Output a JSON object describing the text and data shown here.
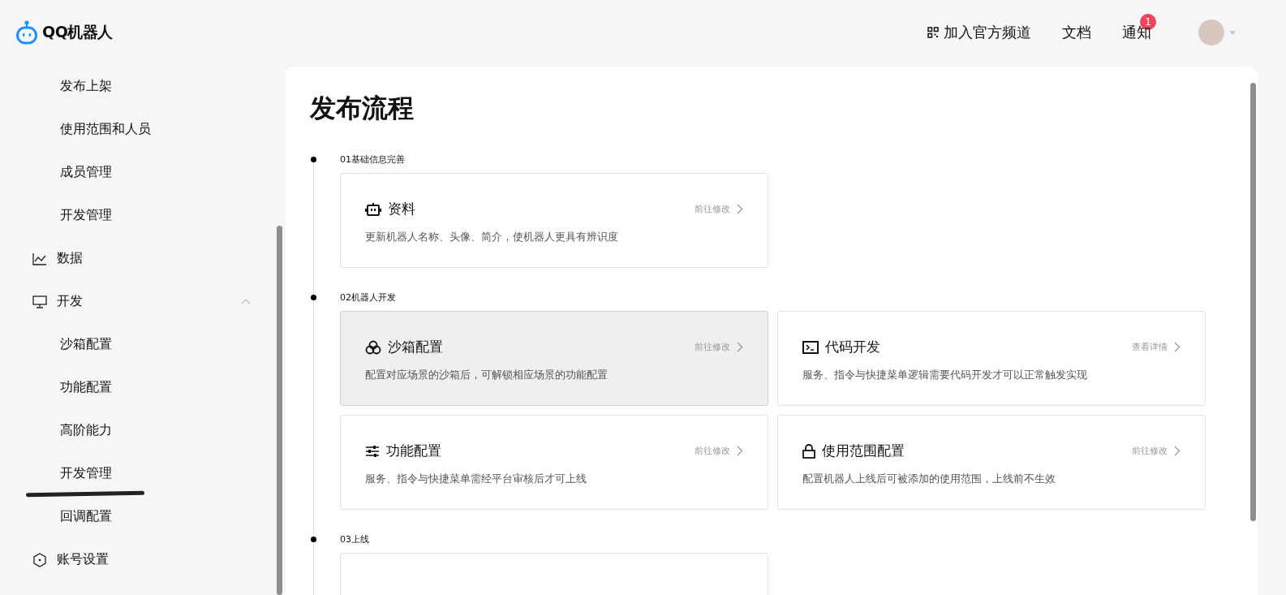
{
  "header": {
    "logo": "QQ机器人",
    "links": [
      {
        "kind": "channel",
        "label": "加入官方频道"
      },
      {
        "kind": "plain",
        "label": "文档"
      },
      {
        "kind": "notify",
        "label": "通知",
        "badge": "1"
      }
    ]
  },
  "sidebar": {
    "items": [
      {
        "kind": "sub",
        "label": "发布上架"
      },
      {
        "kind": "sub",
        "label": "使用范围和人员"
      },
      {
        "kind": "sub",
        "label": "成员管理"
      },
      {
        "kind": "sub",
        "label": "开发管理"
      },
      {
        "kind": "group",
        "label": "数据"
      },
      {
        "kind": "group",
        "label": "开发",
        "expanded": true
      },
      {
        "kind": "sub",
        "label": "沙箱配置"
      },
      {
        "kind": "sub",
        "label": "功能配置"
      },
      {
        "kind": "sub",
        "label": "高阶能力"
      },
      {
        "kind": "sub",
        "label": "开发管理",
        "annotated": true
      },
      {
        "kind": "sub",
        "label": "回调配置"
      },
      {
        "kind": "group",
        "label": "账号设置"
      }
    ]
  },
  "main": {
    "title": "发布流程",
    "steps": [
      {
        "label": "01基础信息完善",
        "cards": [
          {
            "title": "资料",
            "link": "前往修改",
            "desc": "更新机器人名称、头像、简介，使机器人更具有辨识度",
            "highlighted": false
          }
        ]
      },
      {
        "label": "02机器人开发",
        "cards": [
          {
            "title": "沙箱配置",
            "link": "前往修改",
            "desc": "配置对应场景的沙箱后，可解锁相应场景的功能配置",
            "highlighted": true
          },
          {
            "title": "代码开发",
            "link": "查看详情",
            "desc": "服务、指令与快捷菜单逻辑需要代码开发才可以正常触发实现",
            "highlighted": false
          },
          {
            "title": "功能配置",
            "link": "前往修改",
            "desc": "服务、指令与快捷菜单需经平台审核后才可上线",
            "highlighted": false
          },
          {
            "title": "使用范围配置",
            "link": "前往修改",
            "desc": "配置机器人上线后可被添加的使用范围，上线前不生效",
            "highlighted": false
          }
        ]
      },
      {
        "label": "03上线"
      }
    ]
  }
}
